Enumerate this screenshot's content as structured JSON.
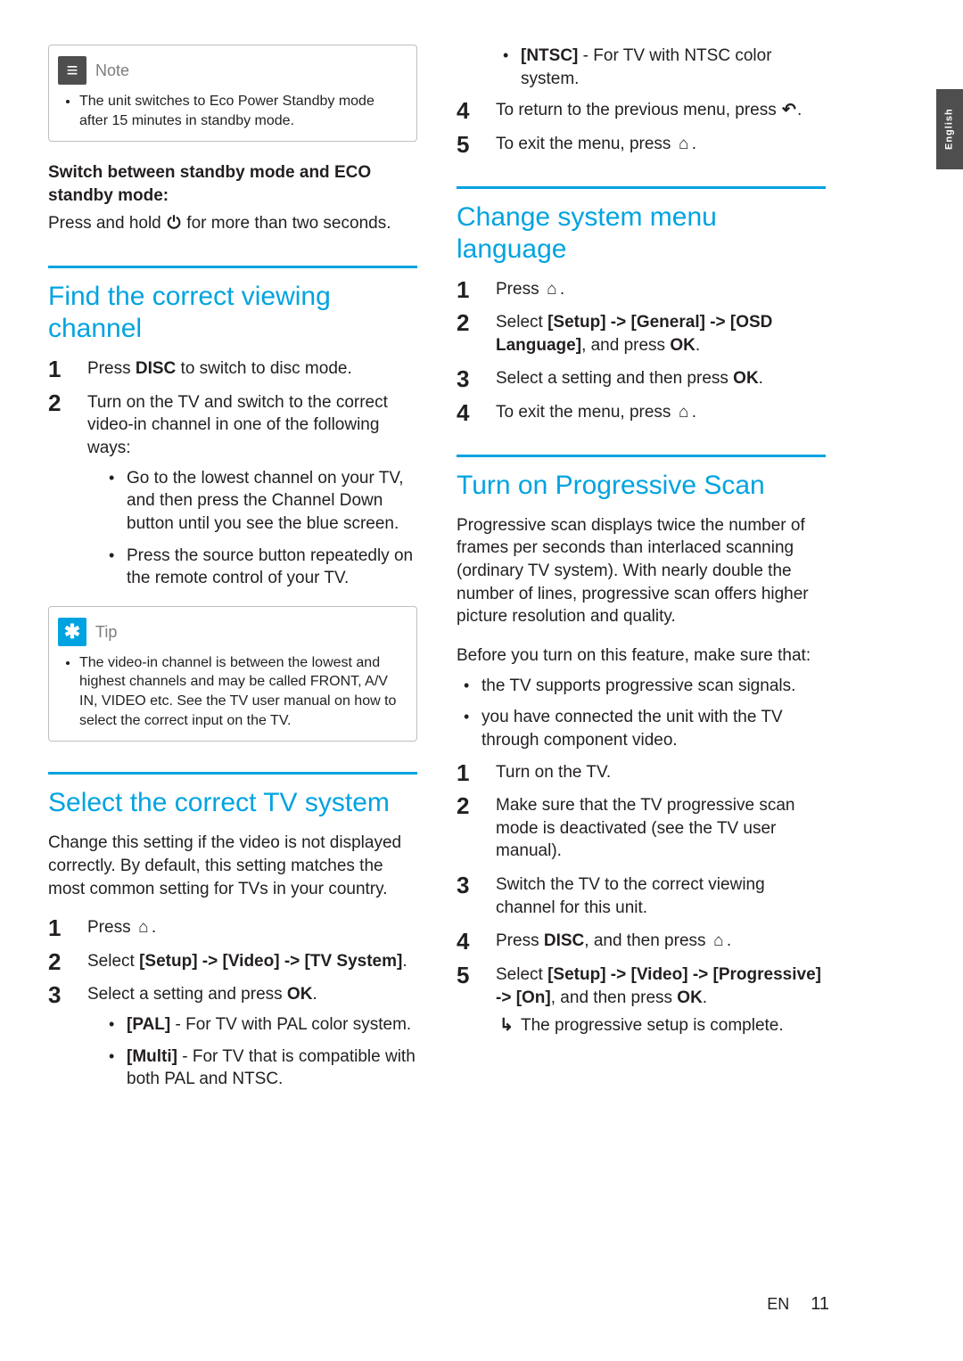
{
  "lang_tab": "English",
  "note": {
    "label": "Note",
    "body": "The unit switches to Eco Power Standby mode after 15 minutes in standby mode."
  },
  "standby_switch": {
    "heading": "Switch between standby mode and ECO standby mode:",
    "text_pre": "Press and hold ",
    "text_post": " for more than two seconds."
  },
  "section_viewing": {
    "title": "Find the correct viewing channel",
    "step1_pre": "Press ",
    "step1_key": "DISC",
    "step1_post": " to switch to disc mode.",
    "step2": "Turn on the TV and switch to the correct video-in channel in one of the following ways:",
    "bullets": [
      "Go to the lowest channel on your TV, and then press the Channel Down button until you see the blue screen.",
      "Press the source button repeatedly on the remote control of your TV."
    ]
  },
  "tip": {
    "label": "Tip",
    "body": "The video-in channel is between the lowest and highest channels and may be called FRONT, A/V IN, VIDEO etc. See the TV user manual on how to select the correct input on the TV."
  },
  "section_tvsys": {
    "title": "Select the correct TV system",
    "intro": "Change this setting if the video is not displayed correctly. By default, this setting matches the most common setting for TVs in your country.",
    "step1": "Press ",
    "step2_pre": "Select ",
    "step2_path": "[Setup] -> [Video] -> [TV System]",
    "step2_post": ".",
    "step3_pre": "Select a setting and press ",
    "step3_key": "OK",
    "step3_post": ".",
    "opts": {
      "pal_key": "[PAL]",
      "pal_txt": " - For TV with PAL color system.",
      "multi_key": "[Multi]",
      "multi_txt": " - For TV that is compatible with both PAL and NTSC.",
      "ntsc_key": "[NTSC]",
      "ntsc_txt": " - For TV with NTSC color system."
    },
    "step4": "To return to the previous menu, press ",
    "step5": "To exit the menu, press "
  },
  "section_lang": {
    "title": "Change system menu language",
    "step1": "Press ",
    "step2_pre": "Select ",
    "step2_path": "[Setup] -> [General] -> [OSD Language]",
    "step2_mid": ", and press ",
    "step2_key": "OK",
    "step2_post": ".",
    "step3_pre": "Select a setting and then press ",
    "step3_key": "OK",
    "step3_post": ".",
    "step4": "To exit the menu, press "
  },
  "section_prog": {
    "title": "Turn on Progressive Scan",
    "intro": "Progressive scan displays twice the number of frames per seconds than interlaced scanning (ordinary TV system). With nearly double the number of lines, progressive scan offers higher picture resolution and quality.",
    "before": "Before you turn on this feature, make sure that:",
    "prereq": [
      "the TV supports progressive scan signals.",
      "you have connected the unit with the TV through component video."
    ],
    "step1": "Turn on the TV.",
    "step2": "Make sure that the TV progressive scan mode is deactivated (see the TV user manual).",
    "step3": "Switch the TV to the correct viewing channel for this unit.",
    "step4_pre": "Press ",
    "step4_key": "DISC",
    "step4_mid": ", and then press ",
    "step5_pre": "Select ",
    "step5_path": "[Setup] -> [Video] -> [Progressive] -> [On]",
    "step5_mid": ", and then press ",
    "step5_key": "OK",
    "step5_post": ".",
    "step5_sub": "The progressive setup is complete."
  },
  "footer": {
    "lang": "EN",
    "page": "11"
  }
}
